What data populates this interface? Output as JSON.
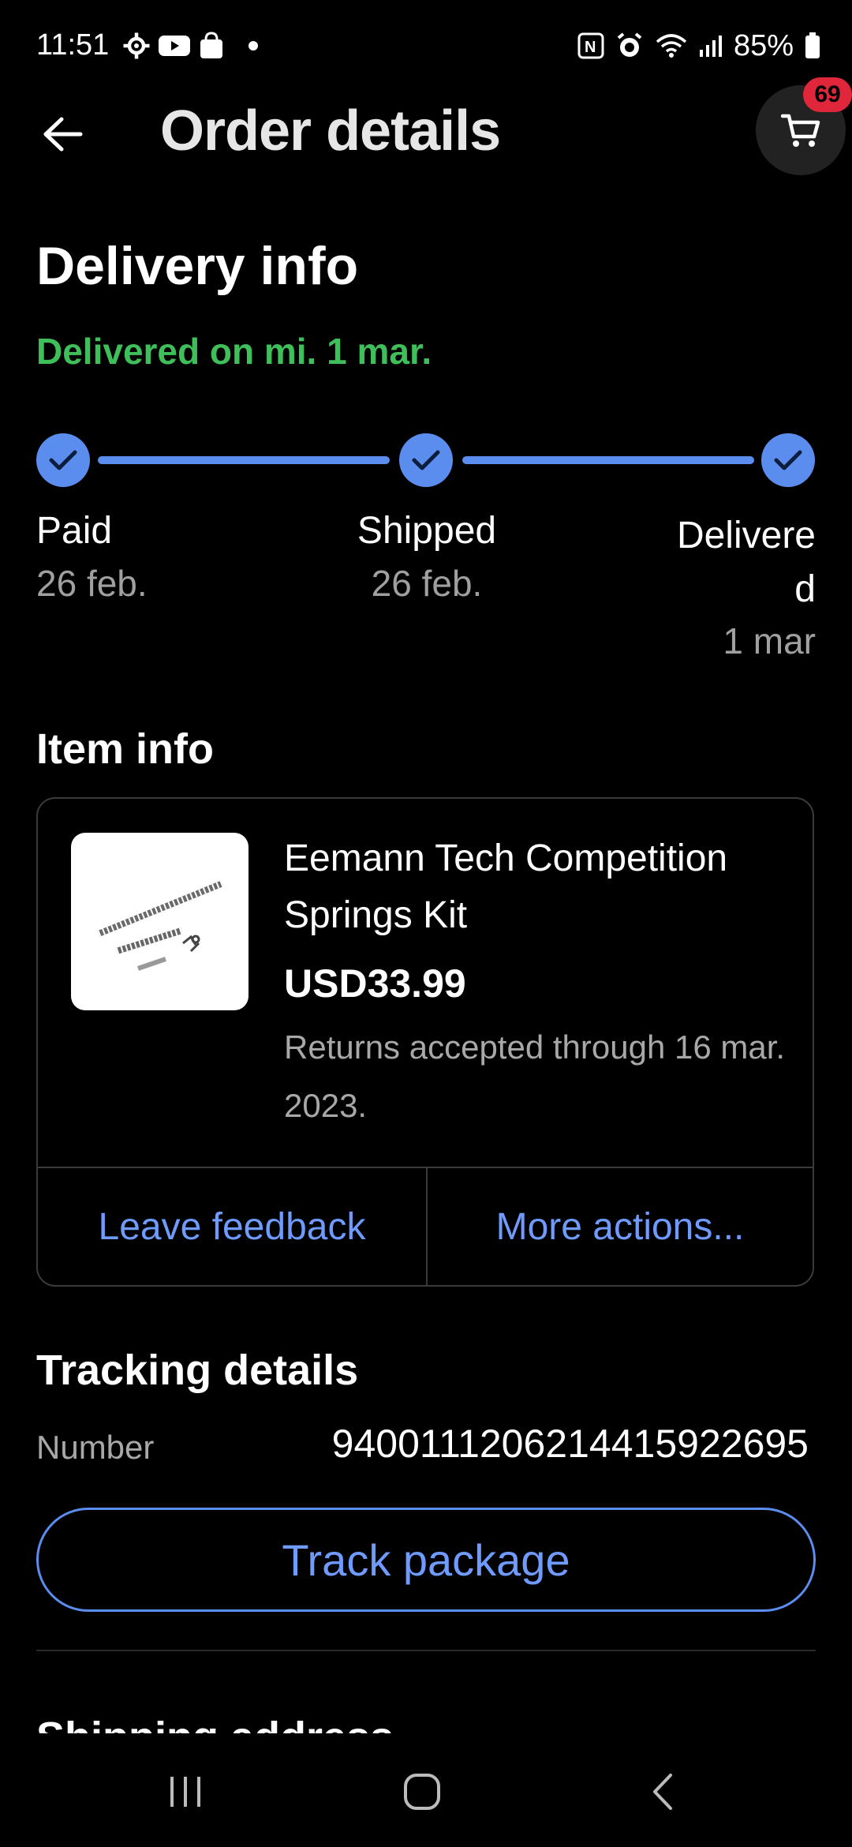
{
  "status_bar": {
    "time": "11:51",
    "battery": "85%",
    "icons_left": [
      "gear-icon",
      "youtube-icon",
      "shopping-bag-icon"
    ],
    "icons_right": [
      "nfc-icon",
      "alarm-icon",
      "wifi-icon",
      "signal-icon",
      "battery-icon"
    ]
  },
  "header": {
    "title": "Order details",
    "cart_badge": "69"
  },
  "delivery": {
    "section_title": "Delivery info",
    "status": "Delivered on mi. 1 mar.",
    "status_color": "#3fbf5a",
    "steps": [
      {
        "label": "Paid",
        "date": "26 feb."
      },
      {
        "label": "Shipped",
        "date": "26 feb."
      },
      {
        "label_line1": "Delivere",
        "label_line2": "d",
        "date": "1 mar"
      }
    ]
  },
  "item": {
    "section_title": "Item info",
    "title": "Eemann Tech Competition Springs Kit",
    "price": "USD33.99",
    "returns": "Returns accepted through 16 mar. 2023.",
    "actions": {
      "leave_feedback": "Leave feedback",
      "more_actions": "More actions..."
    }
  },
  "tracking": {
    "section_title": "Tracking details",
    "number_label": "Number",
    "number_value": "9400111206214415922695",
    "track_button": "Track package"
  },
  "next_section_title": "Shipping address",
  "colors": {
    "accent": "#5b8def",
    "link": "#6f9bff",
    "badge": "#e0263a",
    "background": "#000000"
  }
}
